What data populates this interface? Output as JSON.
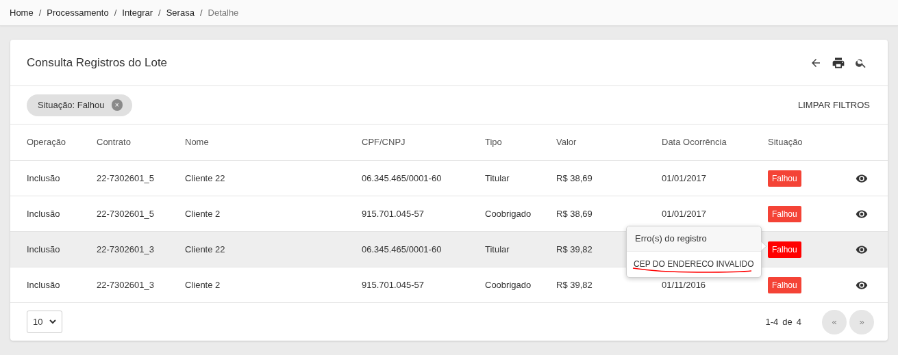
{
  "breadcrumb": [
    {
      "label": "Home",
      "current": false
    },
    {
      "label": "Processamento",
      "current": false
    },
    {
      "label": "Integrar",
      "current": false
    },
    {
      "label": "Serasa",
      "current": false
    },
    {
      "label": "Detalhe",
      "current": true
    }
  ],
  "breadcrumb_separator": "/",
  "card": {
    "title": "Consulta Registros do Lote"
  },
  "filter_chip": {
    "label": "Situação: Falhou",
    "remove": "×"
  },
  "clear_filters": "LIMPAR FILTROS",
  "table": {
    "columns": [
      "Operação",
      "Contrato",
      "Nome",
      "CPF/CNPJ",
      "Tipo",
      "Valor",
      "Data Ocorrência",
      "Situação"
    ],
    "rows": [
      {
        "operation": "Inclusão",
        "contract": "22-7302601_5",
        "name": "Cliente 22",
        "document": "06.345.465/0001-60",
        "type": "Titular",
        "value": "R$ 38,69",
        "date": "01/01/2017",
        "status": "Falhou",
        "selected": false
      },
      {
        "operation": "Inclusão",
        "contract": "22-7302601_5",
        "name": "Cliente 2",
        "document": "915.701.045-57",
        "type": "Coobrigado",
        "value": "R$ 38,69",
        "date": "01/01/2017",
        "status": "Falhou",
        "selected": false
      },
      {
        "operation": "Inclusão",
        "contract": "22-7302601_3",
        "name": "Cliente 22",
        "document": "06.345.465/0001-60",
        "type": "Titular",
        "value": "R$ 39,82",
        "status": "Falhou",
        "selected": true
      },
      {
        "operation": "Inclusão",
        "contract": "22-7302601_3",
        "name": "Cliente 2",
        "document": "915.701.045-57",
        "type": "Coobrigado",
        "value": "R$ 39,82",
        "date": "01/11/2016",
        "status": "Falhou",
        "selected": false
      }
    ]
  },
  "popover": {
    "title": "Erro(s) do registro",
    "message": "CEP DO ENDERECO INVALIDO"
  },
  "footer": {
    "page_size": "10",
    "range": "1-4",
    "of": "de",
    "total": "4",
    "prev": {
      "label": "«",
      "disabled": true
    },
    "next": {
      "label": "»",
      "disabled": true
    }
  }
}
